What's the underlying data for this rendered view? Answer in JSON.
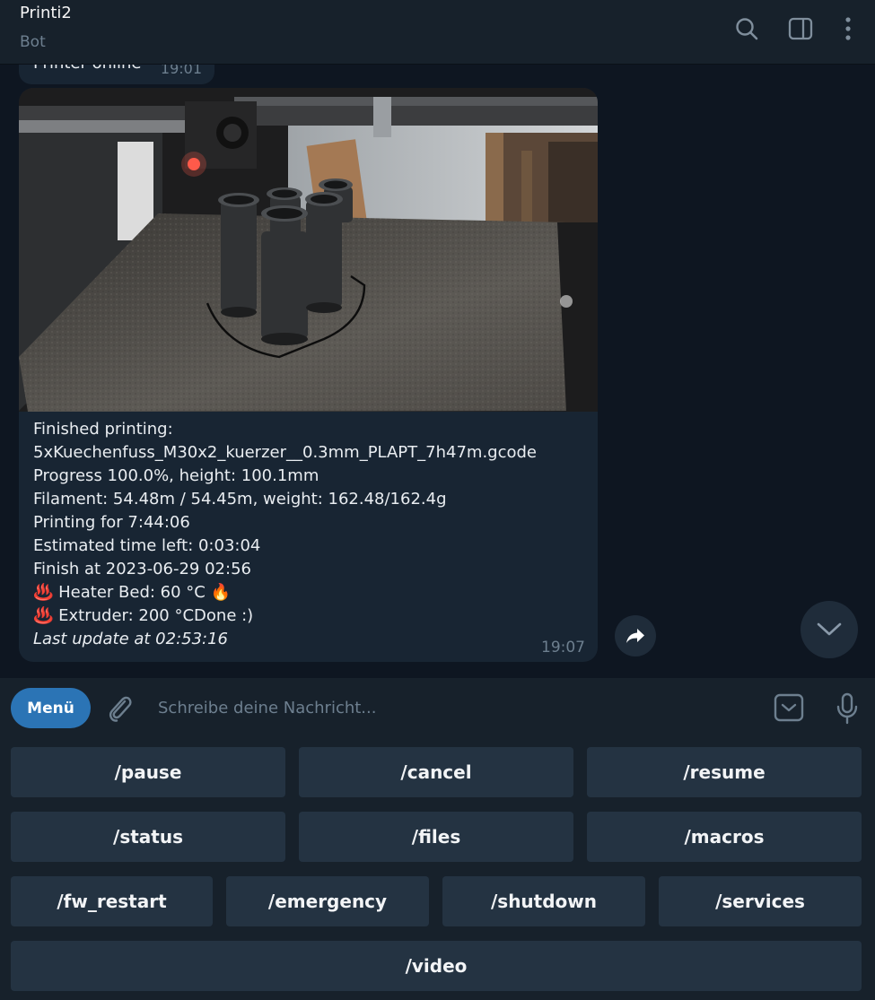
{
  "header": {
    "title": "Printi2",
    "subtitle": "Bot"
  },
  "previous_message": {
    "text": "Printer online",
    "time": "19:01"
  },
  "message": {
    "lines": [
      "Finished printing:",
      "5xKuechenfuss_M30x2_kuerzer__0.3mm_PLAPT_7h47m.gcode",
      "Progress 100.0%, height: 100.1mm",
      "Filament: 54.48m / 54.45m, weight: 162.48/162.4g",
      "Printing for 7:44:06",
      "Estimated time left: 0:03:04",
      "Finish at 2023-06-29 02:56",
      "♨️ Heater Bed: 60 °C 🔥",
      "♨️ Extruder: 200 °CDone :)"
    ],
    "last_update": "Last update at 02:53:16",
    "time": "19:07"
  },
  "composer": {
    "menu_label": "Menü",
    "placeholder": "Schreibe deine Nachricht..."
  },
  "keyboard": {
    "row1": [
      "/pause",
      "/cancel",
      "/resume"
    ],
    "row2": [
      "/status",
      "/files",
      "/macros"
    ],
    "row3": [
      "/fw_restart",
      "/emergency",
      "/shutdown",
      "/services"
    ],
    "row4": [
      "/video"
    ]
  },
  "colors": {
    "background": "#0e1621",
    "panel": "#17212b",
    "bubble": "#182533",
    "accent": "#2b74b5",
    "key": "#243342"
  },
  "icons": [
    "search-icon",
    "sidebar-toggle-icon",
    "more-vertical-icon",
    "forward-icon",
    "chevron-down-icon",
    "paperclip-icon",
    "bot-keyboard-icon",
    "microphone-icon"
  ]
}
